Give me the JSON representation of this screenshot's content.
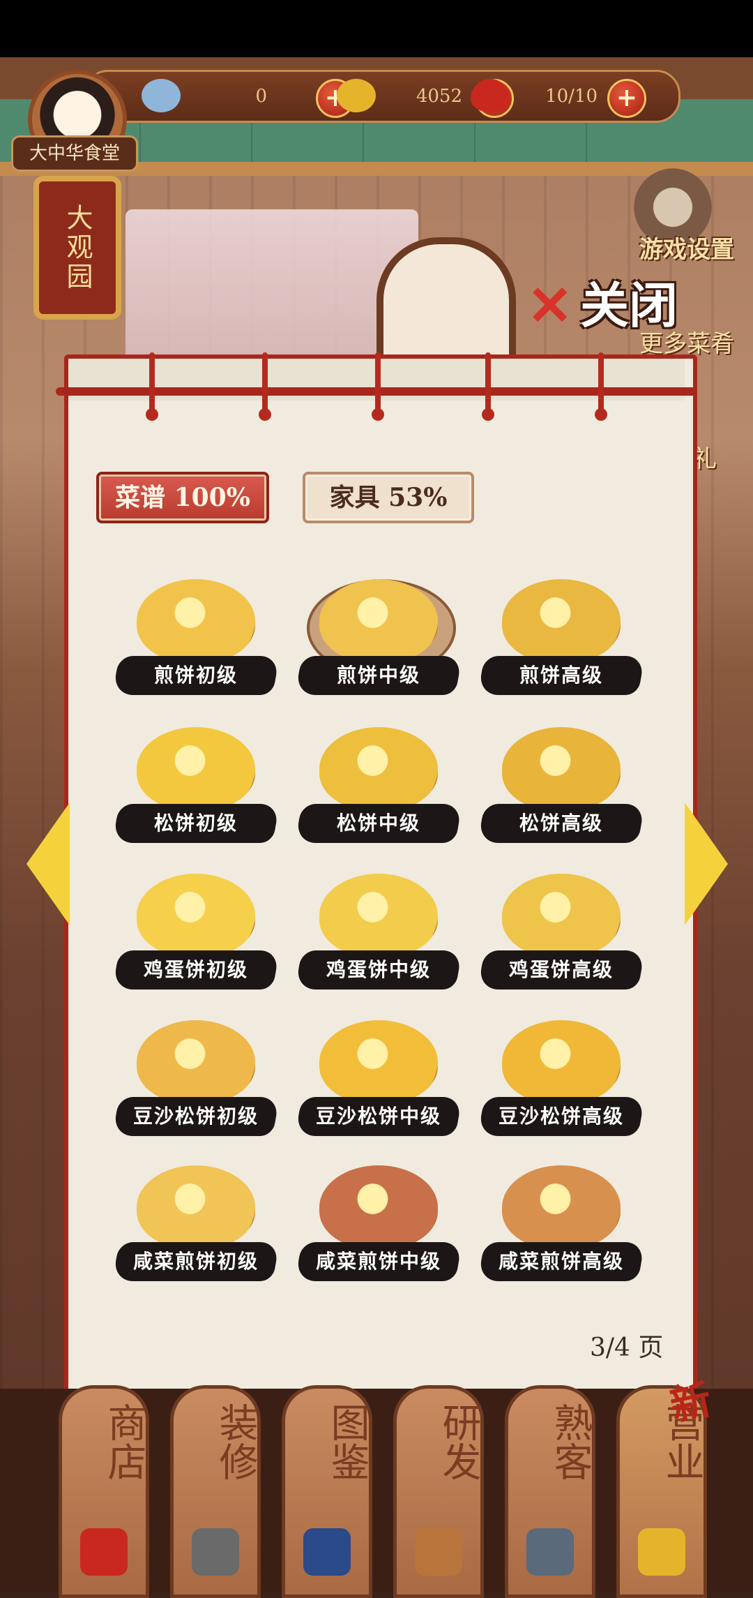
{
  "top_bar": {
    "shop_name": "大中华食堂",
    "area_sign": "大观园",
    "resources": [
      {
        "name": "silver-ingot",
        "value": "0",
        "icon_color": "#8fb6d9"
      },
      {
        "name": "gold-coin",
        "value": "4052",
        "icon_color": "#e6b42a"
      },
      {
        "name": "stamina-heart",
        "value": "10/10",
        "icon_color": "#c8281e"
      }
    ],
    "plus_symbol": "+"
  },
  "side": {
    "settings_label": "游戏设置",
    "close_label": "关闭",
    "close_symbol": "✕",
    "label_behind_1": "更多菜肴",
    "label_behind_2": "有礼"
  },
  "panel": {
    "tabs": [
      {
        "label": "菜谱 100%",
        "active": true
      },
      {
        "label": "家具 53%",
        "active": false
      }
    ],
    "items": [
      {
        "label": "煎饼初级",
        "color": "#f2c34a"
      },
      {
        "label": "煎饼中级",
        "color": "#f0c24e"
      },
      {
        "label": "煎饼高级",
        "color": "#e9b840"
      },
      {
        "label": "松饼初级",
        "color": "#f4c83e"
      },
      {
        "label": "松饼中级",
        "color": "#eebf3c"
      },
      {
        "label": "松饼高级",
        "color": "#e8b43a"
      },
      {
        "label": "鸡蛋饼初级",
        "color": "#f6d04a"
      },
      {
        "label": "鸡蛋饼中级",
        "color": "#f3cc4c"
      },
      {
        "label": "鸡蛋饼高级",
        "color": "#efc44a"
      },
      {
        "label": "豆沙松饼初级",
        "color": "#efb84a"
      },
      {
        "label": "豆沙松饼中级",
        "color": "#f2be3a"
      },
      {
        "label": "豆沙松饼高级",
        "color": "#f0b836"
      },
      {
        "label": "咸菜煎饼初级",
        "color": "#f1c456"
      },
      {
        "label": "咸菜煎饼中级",
        "color": "#c8704a"
      },
      {
        "label": "咸菜煎饼高级",
        "color": "#d8904e"
      }
    ],
    "page": "3/4 页"
  },
  "bottom_nav": [
    {
      "label": "商店",
      "icon": "gift-box-icon"
    },
    {
      "label": "装修",
      "icon": "hammer-icon"
    },
    {
      "label": "图鉴",
      "icon": "book-icon"
    },
    {
      "label": "研发",
      "icon": "pot-icon"
    },
    {
      "label": "熟客",
      "icon": "customer-icon"
    },
    {
      "label": "营业",
      "icon": "wok-icon"
    }
  ],
  "new_badge": "新"
}
